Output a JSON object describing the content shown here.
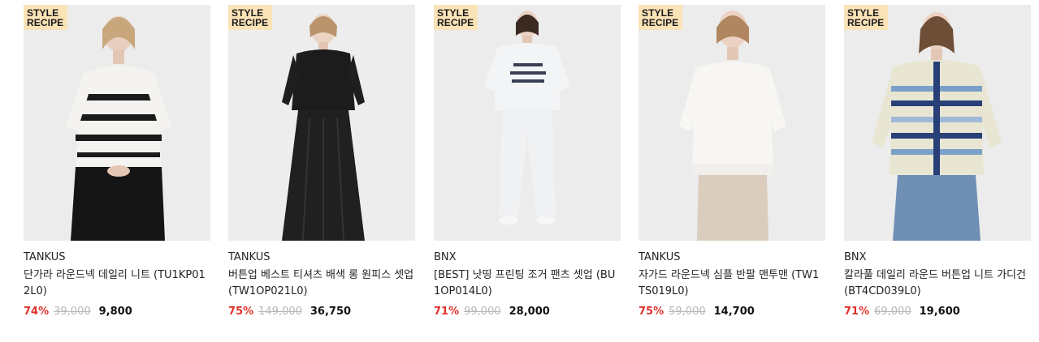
{
  "products": [
    {
      "badge_line1": "STYLE",
      "badge_line2": "RECIPE",
      "brand": "TANKUS",
      "name": "단가라 라운드넥 데일리 니트 (TU1KP012L0)",
      "discount_rate": "74%",
      "original_price": "39,000",
      "sale_price": "9,800"
    },
    {
      "badge_line1": "STYLE",
      "badge_line2": "RECIPE",
      "brand": "TANKUS",
      "name": "버튼업 베스트 티셔츠 배색 롱 원피스 셋업 (TW1OP021L0)",
      "discount_rate": "75%",
      "original_price": "149,000",
      "sale_price": "36,750"
    },
    {
      "badge_line1": "STYLE",
      "badge_line2": "RECIPE",
      "brand": "BNX",
      "name": "[BEST] 낫띵 프린팅 조거 팬츠 셋업 (BU1OP014L0)",
      "discount_rate": "71%",
      "original_price": "99,000",
      "sale_price": "28,000"
    },
    {
      "badge_line1": "STYLE",
      "badge_line2": "RECIPE",
      "brand": "TANKUS",
      "name": "자가드 라운드넥 심플 반팔 맨투맨 (TW1TS019L0)",
      "discount_rate": "75%",
      "original_price": "59,000",
      "sale_price": "14,700"
    },
    {
      "badge_line1": "STYLE",
      "badge_line2": "RECIPE",
      "brand": "BNX",
      "name": "칼라풀 데일리 라운드 버튼업 니트 가디건 (BT4CD039L0)",
      "discount_rate": "71%",
      "original_price": "69,000",
      "sale_price": "19,600"
    }
  ],
  "colors": {
    "discount": "#e0312c",
    "badge_bg": "#fbe3b8",
    "original_price": "#b8b8b8"
  }
}
